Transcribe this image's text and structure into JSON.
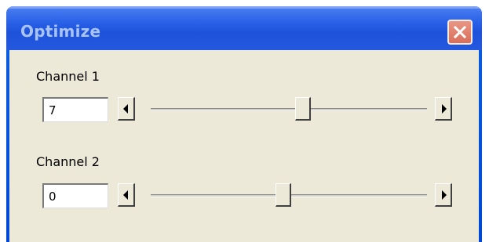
{
  "window": {
    "title": "Optimize",
    "close_icon": "close-icon"
  },
  "channels": [
    {
      "label": "Channel 1",
      "value": "7",
      "slider_fraction": 0.55
    },
    {
      "label": "Channel 2",
      "value": "0",
      "slider_fraction": 0.48
    }
  ],
  "icons": {
    "decrement": "arrow-left-icon",
    "increment": "arrow-right-icon"
  },
  "colors": {
    "titlebar": "#2a62e8",
    "title_text": "#a8c4f7",
    "close_button": "#d86f5b",
    "client_background": "#ece9d8"
  }
}
